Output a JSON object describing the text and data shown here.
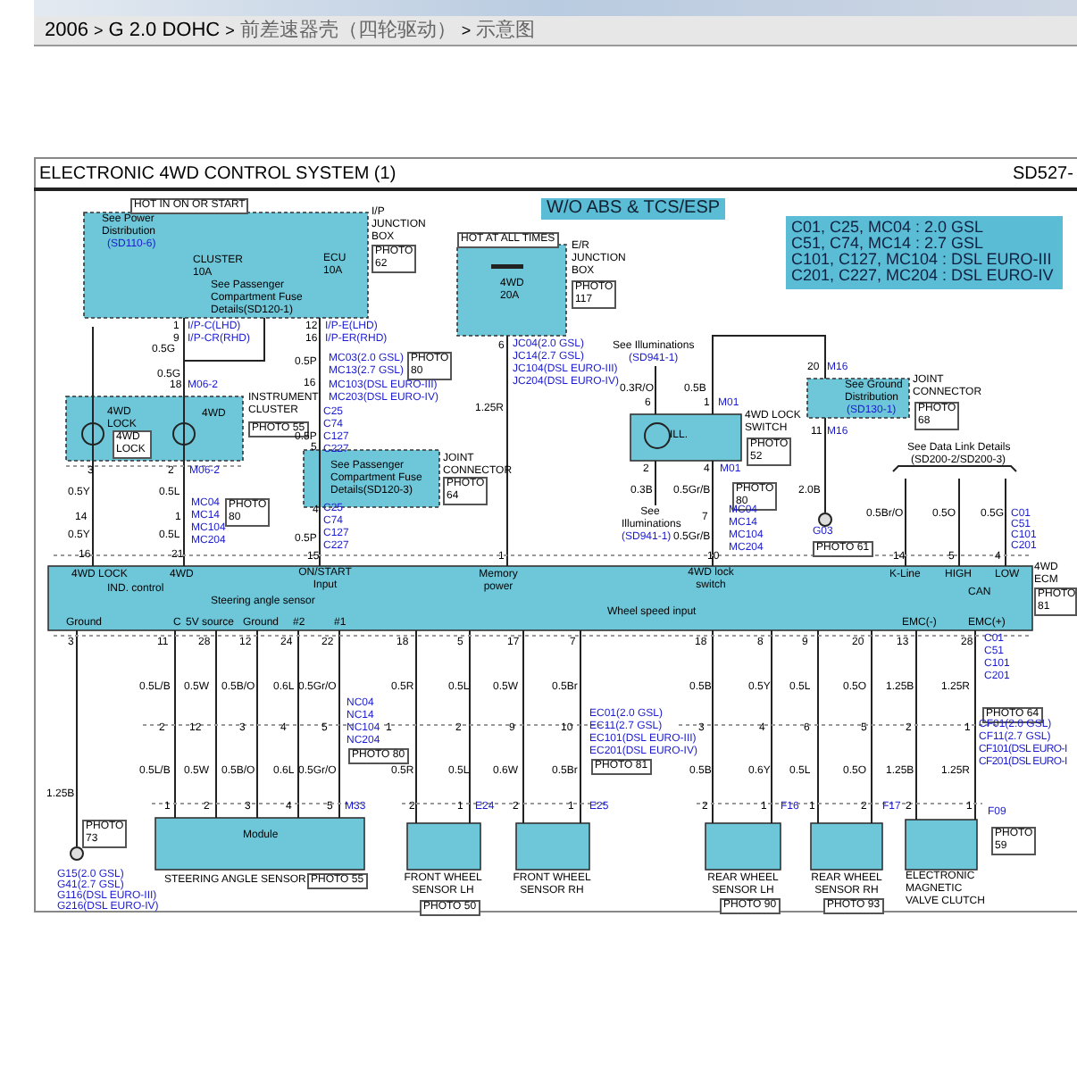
{
  "breadcrumb": [
    {
      "text": "2006",
      "kind": "link"
    },
    {
      "text": ">",
      "kind": "sep"
    },
    {
      "text": "G 2.0 DOHC",
      "kind": "link"
    },
    {
      "text": ">",
      "kind": "sep"
    },
    {
      "text": "前差速器壳（四轮驱动）",
      "kind": "page"
    },
    {
      "text": ">",
      "kind": "sep"
    },
    {
      "text": "示意图",
      "kind": "page"
    }
  ],
  "diagram": {
    "title": "ELECTRONIC 4WD CONTROL SYSTEM (1)",
    "sheet_id": "SD527-",
    "labels": [
      {
        "text": "HOT IN ON OR START",
        "kind": "tag"
      },
      {
        "text": "See Power Distribution",
        "kind": "text"
      },
      {
        "text": "(SD110-6)",
        "kind": "conn"
      },
      {
        "text": "CLUSTER 10A",
        "kind": "text"
      },
      {
        "text": "ECU 10A",
        "kind": "text"
      },
      {
        "text": "See Passenger Compartment Fuse Details(SD120-1)",
        "kind": "text"
      },
      {
        "text": "I/P JUNCTION BOX",
        "kind": "text"
      },
      {
        "text": "PHOTO 62",
        "kind": "tag"
      },
      {
        "text": "HOT AT ALL TIMES",
        "kind": "tag"
      },
      {
        "text": "4WD 20A",
        "kind": "text"
      },
      {
        "text": "E/R JUNCTION BOX",
        "kind": "text"
      },
      {
        "text": "PHOTO 117",
        "kind": "tag"
      },
      {
        "text": "W/O ABS & TCS/ESP",
        "kind": "banner"
      },
      {
        "text": "C01, C25, MC04 : 2.0 GSL",
        "kind": "legend"
      },
      {
        "text": "C51, C74, MC14 : 2.7 GSL",
        "kind": "legend"
      },
      {
        "text": "C101, C127, MC104 : DSL EURO-III",
        "kind": "legend"
      },
      {
        "text": "C201, C227, MC204 : DSL EURO-IV",
        "kind": "legend"
      },
      {
        "text": "1",
        "kind": "pin"
      },
      {
        "text": "I/P-C(LHD)",
        "kind": "conn"
      },
      {
        "text": "9",
        "kind": "pin"
      },
      {
        "text": "I/P-CR(RHD)",
        "kind": "conn"
      },
      {
        "text": "0.5G",
        "kind": "wire"
      },
      {
        "text": "0.5G",
        "kind": "wire"
      },
      {
        "text": "18",
        "kind": "pin"
      },
      {
        "text": "M06-2",
        "kind": "conn"
      },
      {
        "text": "12",
        "kind": "pin"
      },
      {
        "text": "I/P-E(LHD)",
        "kind": "conn"
      },
      {
        "text": "16",
        "kind": "pin"
      },
      {
        "text": "I/P-ER(RHD)",
        "kind": "conn"
      },
      {
        "text": "0.5P",
        "kind": "wire"
      },
      {
        "text": "MC03(2.0 GSL)",
        "kind": "conn"
      },
      {
        "text": "MC13(2.7 GSL)",
        "kind": "conn"
      },
      {
        "text": "PHOTO 80",
        "kind": "tag"
      },
      {
        "text": "MC103(DSL EURO-III)",
        "kind": "conn"
      },
      {
        "text": "MC203(DSL EURO-IV)",
        "kind": "conn"
      },
      {
        "text": "16",
        "kind": "pin"
      },
      {
        "text": "INSTRUMENT CLUSTER",
        "kind": "text"
      },
      {
        "text": "PHOTO 55",
        "kind": "tag"
      },
      {
        "text": "4WD LOCK",
        "kind": "text"
      },
      {
        "text": "4WD LOCK",
        "kind": "tag"
      },
      {
        "text": "4WD",
        "kind": "text"
      },
      {
        "text": "C25",
        "kind": "conn"
      },
      {
        "text": "C74",
        "kind": "conn"
      },
      {
        "text": "C127",
        "kind": "conn"
      },
      {
        "text": "C227",
        "kind": "conn"
      },
      {
        "text": "0.5P",
        "kind": "wire"
      },
      {
        "text": "5",
        "kind": "pin"
      },
      {
        "text": "See Passenger Compartment Fuse Details(SD120-3)",
        "kind": "text"
      },
      {
        "text": "JOINT CONNECTOR",
        "kind": "text"
      },
      {
        "text": "PHOTO 64",
        "kind": "tag"
      },
      {
        "text": "3",
        "kind": "pin"
      },
      {
        "text": "2",
        "kind": "pin"
      },
      {
        "text": "M06-2",
        "kind": "conn"
      },
      {
        "text": "0.5Y",
        "kind": "wire"
      },
      {
        "text": "0.5L",
        "kind": "wire"
      },
      {
        "text": "14",
        "kind": "pin"
      },
      {
        "text": "1",
        "kind": "pin"
      },
      {
        "text": "MC04",
        "kind": "conn"
      },
      {
        "text": "MC14",
        "kind": "conn"
      },
      {
        "text": "MC104",
        "kind": "conn"
      },
      {
        "text": "MC204",
        "kind": "conn"
      },
      {
        "text": "PHOTO 80",
        "kind": "tag"
      },
      {
        "text": "0.5Y",
        "kind": "wire"
      },
      {
        "text": "0.5L",
        "kind": "wire"
      },
      {
        "text": "16",
        "kind": "pin"
      },
      {
        "text": "21",
        "kind": "pin"
      },
      {
        "text": "4",
        "kind": "pin"
      },
      {
        "text": "C25",
        "kind": "conn"
      },
      {
        "text": "C74",
        "kind": "conn"
      },
      {
        "text": "C127",
        "kind": "conn"
      },
      {
        "text": "C227",
        "kind": "conn"
      },
      {
        "text": "0.5P",
        "kind": "wire"
      },
      {
        "text": "15",
        "kind": "pin"
      },
      {
        "text": "6",
        "kind": "pin"
      },
      {
        "text": "JC04(2.0 GSL)",
        "kind": "conn"
      },
      {
        "text": "JC14(2.7 GSL)",
        "kind": "conn"
      },
      {
        "text": "JC104(DSL EURO-III)",
        "kind": "conn"
      },
      {
        "text": "JC204(DSL EURO-IV)",
        "kind": "conn"
      },
      {
        "text": "1.25R",
        "kind": "wire"
      },
      {
        "text": "1",
        "kind": "pin"
      },
      {
        "text": "See Illuminations",
        "kind": "text"
      },
      {
        "text": "(SD941-1)",
        "kind": "conn"
      },
      {
        "text": "0.3R/O",
        "kind": "wire"
      },
      {
        "text": "0.5B",
        "kind": "wire"
      },
      {
        "text": "6",
        "kind": "pin"
      },
      {
        "text": "1",
        "kind": "pin"
      },
      {
        "text": "M01",
        "kind": "conn"
      },
      {
        "text": "ILL.",
        "kind": "text"
      },
      {
        "text": "4WD LOCK SWITCH",
        "kind": "text"
      },
      {
        "text": "PHOTO 52",
        "kind": "tag"
      },
      {
        "text": "2",
        "kind": "pin"
      },
      {
        "text": "4",
        "kind": "pin"
      },
      {
        "text": "M01",
        "kind": "conn"
      },
      {
        "text": "0.3B",
        "kind": "wire"
      },
      {
        "text": "0.5Gr/B",
        "kind": "wire"
      },
      {
        "text": "PHOTO 80",
        "kind": "tag"
      },
      {
        "text": "See Illuminations",
        "kind": "text"
      },
      {
        "text": "7",
        "kind": "pin"
      },
      {
        "text": "(SD941-1)",
        "kind": "conn"
      },
      {
        "text": "0.5Gr/B",
        "kind": "wire"
      },
      {
        "text": "MC04",
        "kind": "conn"
      },
      {
        "text": "MC14",
        "kind": "conn"
      },
      {
        "text": "MC104",
        "kind": "conn"
      },
      {
        "text": "MC204",
        "kind": "conn"
      },
      {
        "text": "10",
        "kind": "pin"
      },
      {
        "text": "20",
        "kind": "pin"
      },
      {
        "text": "M16",
        "kind": "conn"
      },
      {
        "text": "See Ground Distribution",
        "kind": "text"
      },
      {
        "text": "(SD130-1)",
        "kind": "conn"
      },
      {
        "text": "JOINT CONNECTOR",
        "kind": "text"
      },
      {
        "text": "PHOTO 68",
        "kind": "tag"
      },
      {
        "text": "11",
        "kind": "pin"
      },
      {
        "text": "M16",
        "kind": "conn"
      },
      {
        "text": "2.0B",
        "kind": "wire"
      },
      {
        "text": "G03",
        "kind": "conn"
      },
      {
        "text": "PHOTO 61",
        "kind": "tag"
      },
      {
        "text": "See Data Link Details",
        "kind": "text"
      },
      {
        "text": "(SD200-2/SD200-3)",
        "kind": "text"
      },
      {
        "text": "0.5Br/O",
        "kind": "wire"
      },
      {
        "text": "0.5O",
        "kind": "wire"
      },
      {
        "text": "0.5G",
        "kind": "wire"
      },
      {
        "text": "C01",
        "kind": "conn"
      },
      {
        "text": "C51",
        "kind": "conn"
      },
      {
        "text": "C101",
        "kind": "conn"
      },
      {
        "text": "C201",
        "kind": "conn"
      },
      {
        "text": "14",
        "kind": "pin"
      },
      {
        "text": "5",
        "kind": "pin"
      },
      {
        "text": "4",
        "kind": "pin"
      },
      {
        "text": "4WD LOCK",
        "kind": "ecm"
      },
      {
        "text": "4WD",
        "kind": "ecm"
      },
      {
        "text": "IND. control",
        "kind": "ecm"
      },
      {
        "text": "ON/START Input",
        "kind": "ecm"
      },
      {
        "text": "Memory power",
        "kind": "ecm"
      },
      {
        "text": "Steering angle sensor",
        "kind": "ecm"
      },
      {
        "text": "Ground",
        "kind": "ecm"
      },
      {
        "text": "C",
        "kind": "ecm"
      },
      {
        "text": "5V source",
        "kind": "ecm"
      },
      {
        "text": "Ground",
        "kind": "ecm"
      },
      {
        "text": "#2",
        "kind": "ecm"
      },
      {
        "text": "#1",
        "kind": "ecm"
      },
      {
        "text": "4WD lock switch",
        "kind": "ecm"
      },
      {
        "text": "K-Line",
        "kind": "ecm"
      },
      {
        "text": "HIGH",
        "kind": "ecm"
      },
      {
        "text": "LOW",
        "kind": "ecm"
      },
      {
        "text": "CAN",
        "kind": "ecm"
      },
      {
        "text": "Wheel speed input",
        "kind": "ecm"
      },
      {
        "text": "EMC(-)",
        "kind": "ecm"
      },
      {
        "text": "EMC(+)",
        "kind": "ecm"
      },
      {
        "text": "4WD ECM",
        "kind": "text"
      },
      {
        "text": "PHOTO 81",
        "kind": "tag"
      },
      {
        "text": "3",
        "kind": "pin"
      },
      {
        "text": "11",
        "kind": "pin"
      },
      {
        "text": "28",
        "kind": "pin"
      },
      {
        "text": "12",
        "kind": "pin"
      },
      {
        "text": "24",
        "kind": "pin"
      },
      {
        "text": "22",
        "kind": "pin"
      },
      {
        "text": "18",
        "kind": "pin"
      },
      {
        "text": "5",
        "kind": "pin"
      },
      {
        "text": "17",
        "kind": "pin"
      },
      {
        "text": "7",
        "kind": "pin"
      },
      {
        "text": "18",
        "kind": "pin"
      },
      {
        "text": "8",
        "kind": "pin"
      },
      {
        "text": "9",
        "kind": "pin"
      },
      {
        "text": "20",
        "kind": "pin"
      },
      {
        "text": "13",
        "kind": "pin"
      },
      {
        "text": "28",
        "kind": "pin"
      },
      {
        "text": "C01",
        "kind": "conn"
      },
      {
        "text": "C51",
        "kind": "conn"
      },
      {
        "text": "C101",
        "kind": "conn"
      },
      {
        "text": "C201",
        "kind": "conn"
      },
      {
        "text": "0.5L/B",
        "kind": "wire"
      },
      {
        "text": "0.5W",
        "kind": "wire"
      },
      {
        "text": "0.5B/O",
        "kind": "wire"
      },
      {
        "text": "0.6L",
        "kind": "wire"
      },
      {
        "text": "0.5Gr/O",
        "kind": "wire"
      },
      {
        "text": "0.5R",
        "kind": "wire"
      },
      {
        "text": "0.5L",
        "kind": "wire"
      },
      {
        "text": "0.5W",
        "kind": "wire"
      },
      {
        "text": "0.5Br",
        "kind": "wire"
      },
      {
        "text": "0.5B",
        "kind": "wire"
      },
      {
        "text": "0.5Y",
        "kind": "wire"
      },
      {
        "text": "0.5L",
        "kind": "wire"
      },
      {
        "text": "0.5O",
        "kind": "wire"
      },
      {
        "text": "1.25B",
        "kind": "wire"
      },
      {
        "text": "1.25R",
        "kind": "wire"
      },
      {
        "text": "2",
        "kind": "pin"
      },
      {
        "text": "12",
        "kind": "pin"
      },
      {
        "text": "3",
        "kind": "pin"
      },
      {
        "text": "4",
        "kind": "pin"
      },
      {
        "text": "5",
        "kind": "pin"
      },
      {
        "text": "1",
        "kind": "pin"
      },
      {
        "text": "2",
        "kind": "pin"
      },
      {
        "text": "9",
        "kind": "pin"
      },
      {
        "text": "10",
        "kind": "pin"
      },
      {
        "text": "3",
        "kind": "pin"
      },
      {
        "text": "4",
        "kind": "pin"
      },
      {
        "text": "6",
        "kind": "pin"
      },
      {
        "text": "5",
        "kind": "pin"
      },
      {
        "text": "2",
        "kind": "pin"
      },
      {
        "text": "1",
        "kind": "pin"
      },
      {
        "text": "NC04",
        "kind": "conn"
      },
      {
        "text": "NC14",
        "kind": "conn"
      },
      {
        "text": "NC104",
        "kind": "conn"
      },
      {
        "text": "NC204",
        "kind": "conn"
      },
      {
        "text": "PHOTO 80",
        "kind": "tag"
      },
      {
        "text": "EC01(2.0 GSL)",
        "kind": "conn"
      },
      {
        "text": "EC11(2.7 GSL)",
        "kind": "conn"
      },
      {
        "text": "EC101(DSL EURO-III)",
        "kind": "conn"
      },
      {
        "text": "EC201(DSL EURO-IV)",
        "kind": "conn"
      },
      {
        "text": "PHOTO 81",
        "kind": "tag"
      },
      {
        "text": "PHOTO 64",
        "kind": "tag"
      },
      {
        "text": "CF01(2.0 GSL)",
        "kind": "conn"
      },
      {
        "text": "CF11(2.7 GSL)",
        "kind": "conn"
      },
      {
        "text": "CF101(DSL EURO-I",
        "kind": "conn"
      },
      {
        "text": "CF201(DSL EURO-I",
        "kind": "conn"
      },
      {
        "text": "0.5L/B",
        "kind": "wire"
      },
      {
        "text": "0.5W",
        "kind": "wire"
      },
      {
        "text": "0.5B/O",
        "kind": "wire"
      },
      {
        "text": "0.6L",
        "kind": "wire"
      },
      {
        "text": "0.5Gr/O",
        "kind": "wire"
      },
      {
        "text": "0.5R",
        "kind": "wire"
      },
      {
        "text": "0.5L",
        "kind": "wire"
      },
      {
        "text": "0.6W",
        "kind": "wire"
      },
      {
        "text": "0.5Br",
        "kind": "wire"
      },
      {
        "text": "0.5B",
        "kind": "wire"
      },
      {
        "text": "0.6Y",
        "kind": "wire"
      },
      {
        "text": "0.5L",
        "kind": "wire"
      },
      {
        "text": "0.5O",
        "kind": "wire"
      },
      {
        "text": "1.25B",
        "kind": "wire"
      },
      {
        "text": "1.25R",
        "kind": "wire"
      },
      {
        "text": "1.25B",
        "kind": "wire"
      },
      {
        "text": "1",
        "kind": "pin"
      },
      {
        "text": "2",
        "kind": "pin"
      },
      {
        "text": "3",
        "kind": "pin"
      },
      {
        "text": "4",
        "kind": "pin"
      },
      {
        "text": "5",
        "kind": "pin"
      },
      {
        "text": "M33",
        "kind": "conn"
      },
      {
        "text": "2",
        "kind": "pin"
      },
      {
        "text": "1",
        "kind": "pin"
      },
      {
        "text": "E24",
        "kind": "conn"
      },
      {
        "text": "2",
        "kind": "pin"
      },
      {
        "text": "1",
        "kind": "pin"
      },
      {
        "text": "E25",
        "kind": "conn"
      },
      {
        "text": "2",
        "kind": "pin"
      },
      {
        "text": "1",
        "kind": "pin"
      },
      {
        "text": "F16",
        "kind": "conn"
      },
      {
        "text": "1",
        "kind": "pin"
      },
      {
        "text": "2",
        "kind": "pin"
      },
      {
        "text": "F17",
        "kind": "conn"
      },
      {
        "text": "2",
        "kind": "pin"
      },
      {
        "text": "1",
        "kind": "pin"
      },
      {
        "text": "F09",
        "kind": "conn"
      },
      {
        "text": "PHOTO 73",
        "kind": "tag"
      },
      {
        "text": "Module",
        "kind": "text"
      },
      {
        "text": "PHOTO 59",
        "kind": "tag"
      },
      {
        "text": "G15(2.0 GSL)",
        "kind": "conn"
      },
      {
        "text": "G41(2.7 GSL)",
        "kind": "conn"
      },
      {
        "text": "G116(DSL EURO-III)",
        "kind": "conn"
      },
      {
        "text": "G216(DSL EURO-IV)",
        "kind": "conn"
      },
      {
        "text": "STEERING ANGLE SENSOR",
        "kind": "text"
      },
      {
        "text": "PHOTO 55",
        "kind": "tag"
      },
      {
        "text": "FRONT WHEEL SENSOR LH",
        "kind": "text"
      },
      {
        "text": "PHOTO 50",
        "kind": "tag"
      },
      {
        "text": "FRONT WHEEL SENSOR RH",
        "kind": "text"
      },
      {
        "text": "REAR WHEEL SENSOR LH",
        "kind": "text"
      },
      {
        "text": "PHOTO 90",
        "kind": "tag"
      },
      {
        "text": "REAR WHEEL SENSOR RH",
        "kind": "text"
      },
      {
        "text": "PHOTO 93",
        "kind": "tag"
      },
      {
        "text": "ELECTRONIC MAGNETIC VALVE CLUTCH",
        "kind": "text"
      }
    ]
  }
}
